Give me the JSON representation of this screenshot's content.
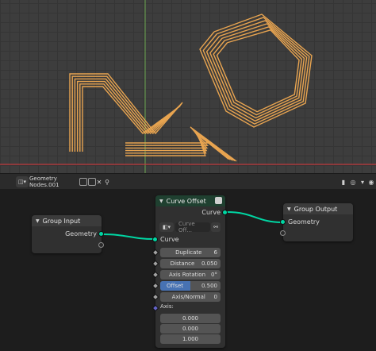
{
  "node_editor_header": {
    "tree_name": "Geometry Nodes.001",
    "pin_icon": "pin-icon"
  },
  "nodes": {
    "group_input": {
      "title": "Group Input",
      "output_label": "Geometry"
    },
    "curve_offset": {
      "title": "Curve Offset",
      "output_label": "Curve",
      "input_label": "Curve",
      "object_placeholder": "Curve Off...",
      "fields": [
        {
          "label": "Duplicate",
          "value": "6"
        },
        {
          "label": "Distance",
          "value": "0.050"
        },
        {
          "label": "Axis Rotation",
          "value": "0°"
        },
        {
          "label": "Offset",
          "value": "0.500"
        },
        {
          "label": "Axis/Normal",
          "value": "0"
        }
      ],
      "axis_label": "Axis:",
      "axis_values": [
        "0.000",
        "0.000",
        "1.000"
      ]
    },
    "group_output": {
      "title": "Group Output",
      "input_label": "Geometry"
    }
  },
  "colors": {
    "curve_orange": "#e8a450",
    "geometry_socket": "#00d6a3",
    "group_header": "#3b3b3b",
    "curve_offset_header": "#1f4030",
    "offset_field_blue": "#4772b3",
    "x_axis_red": "#c0393d",
    "y_axis_green": "#6aa84f"
  }
}
